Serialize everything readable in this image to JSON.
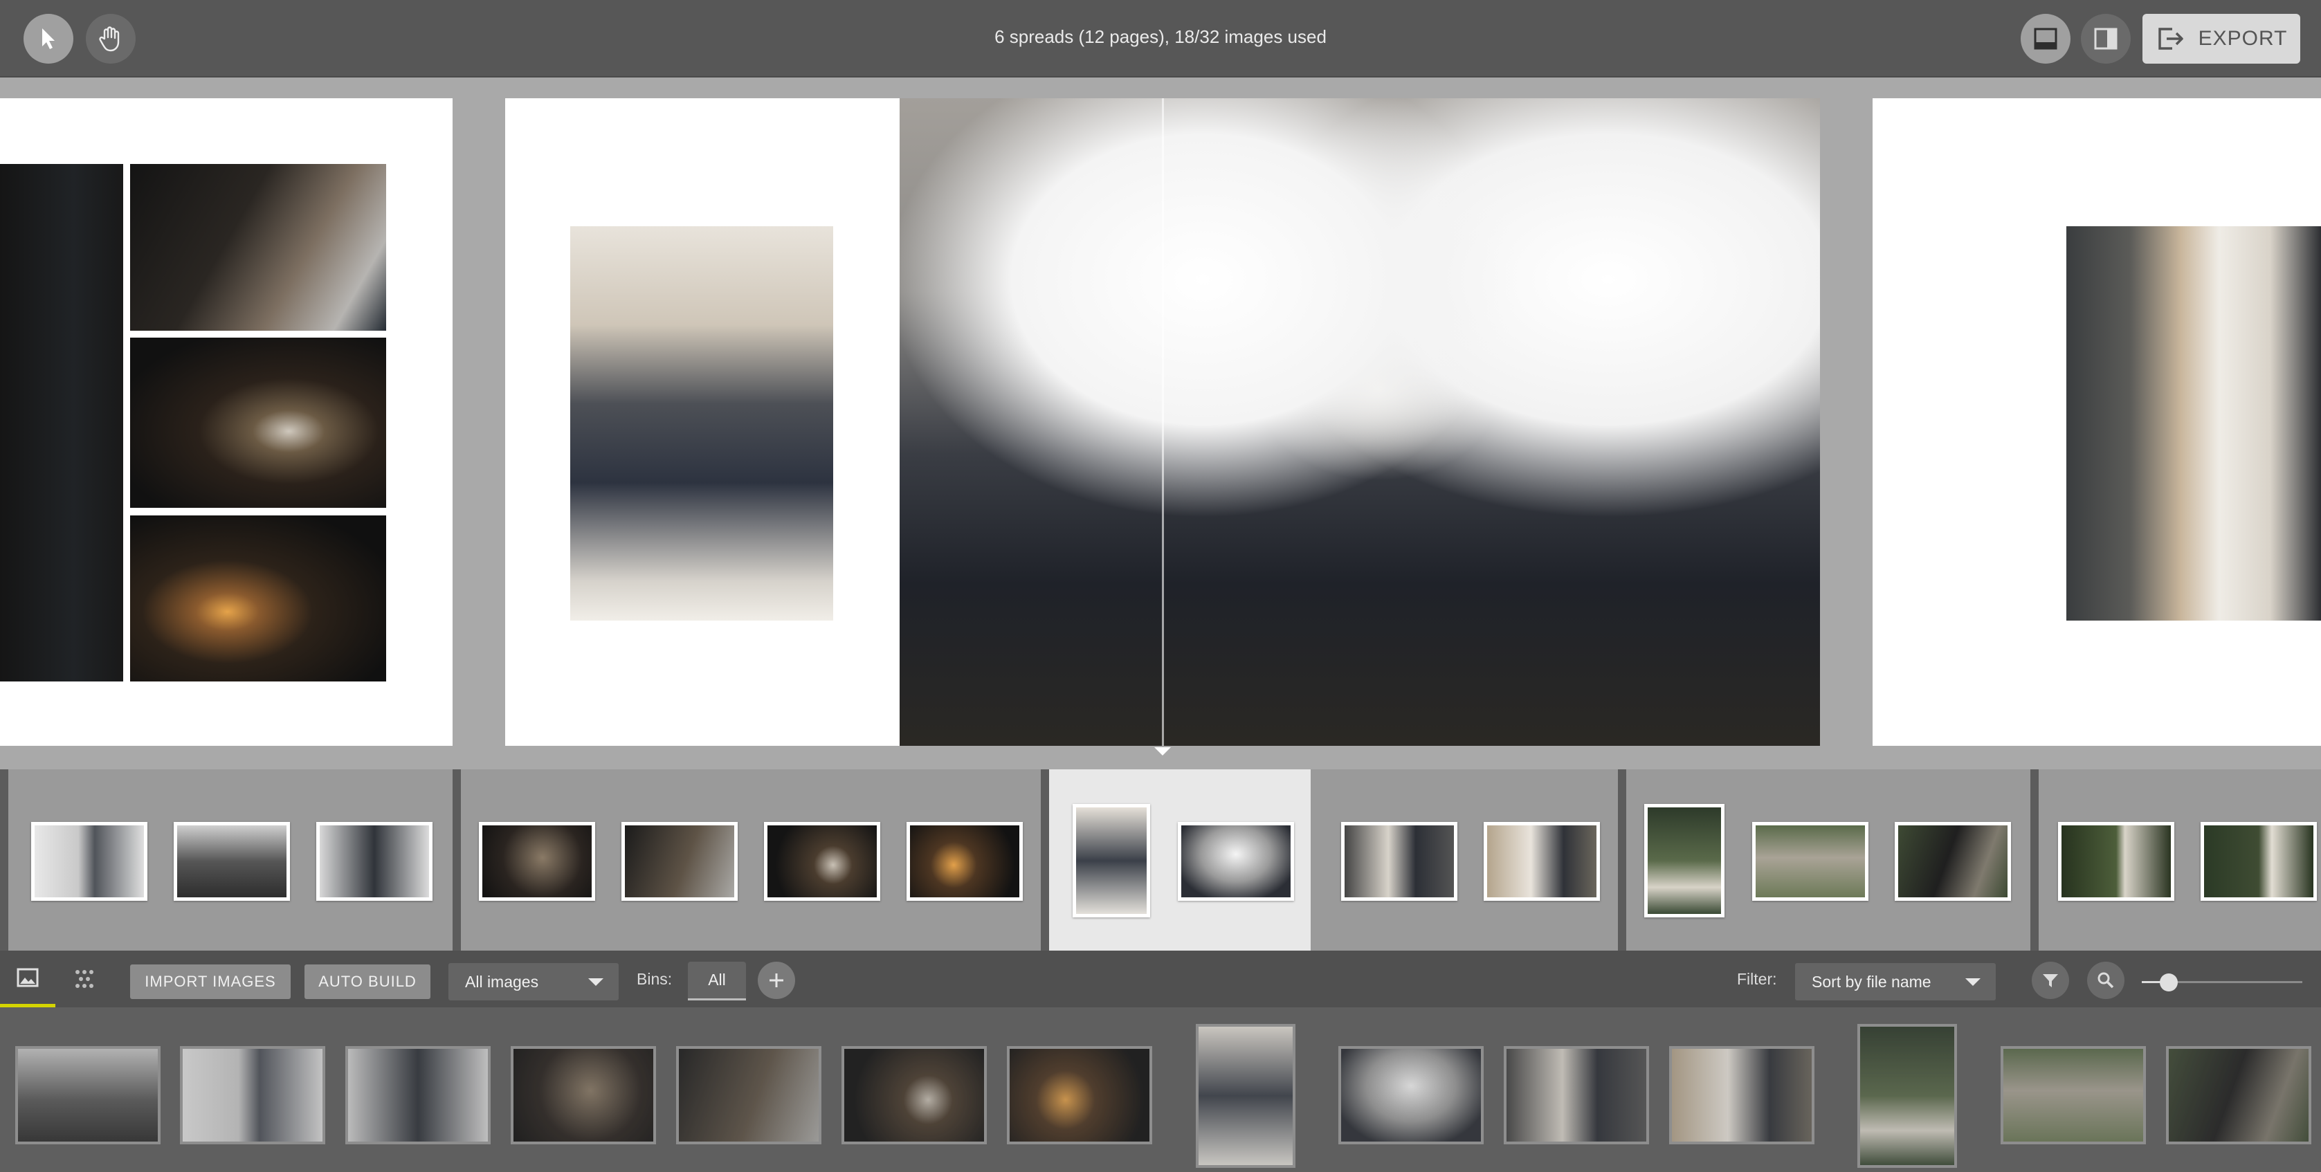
{
  "toolbar": {
    "status_text": "6 spreads (12 pages), 18/32 images used",
    "export_label": "EXPORT",
    "tools": [
      "select-tool",
      "pan-tool"
    ],
    "views": [
      "single-view",
      "split-view"
    ]
  },
  "library_toolbar": {
    "import_label": "IMPORT IMAGES",
    "auto_build_label": "AUTO BUILD",
    "images_select": "All images",
    "bins_label": "Bins:",
    "bin_all": "All",
    "filter_label": "Filter:",
    "sort_select": "Sort by file name",
    "zoom_level": 0.17
  },
  "colors": {
    "toolbar_bg": "#575757",
    "canvas_bg": "#a9a9a9",
    "active_tab_underline": "#d4d400",
    "library_bg": "#5f5f5f"
  }
}
